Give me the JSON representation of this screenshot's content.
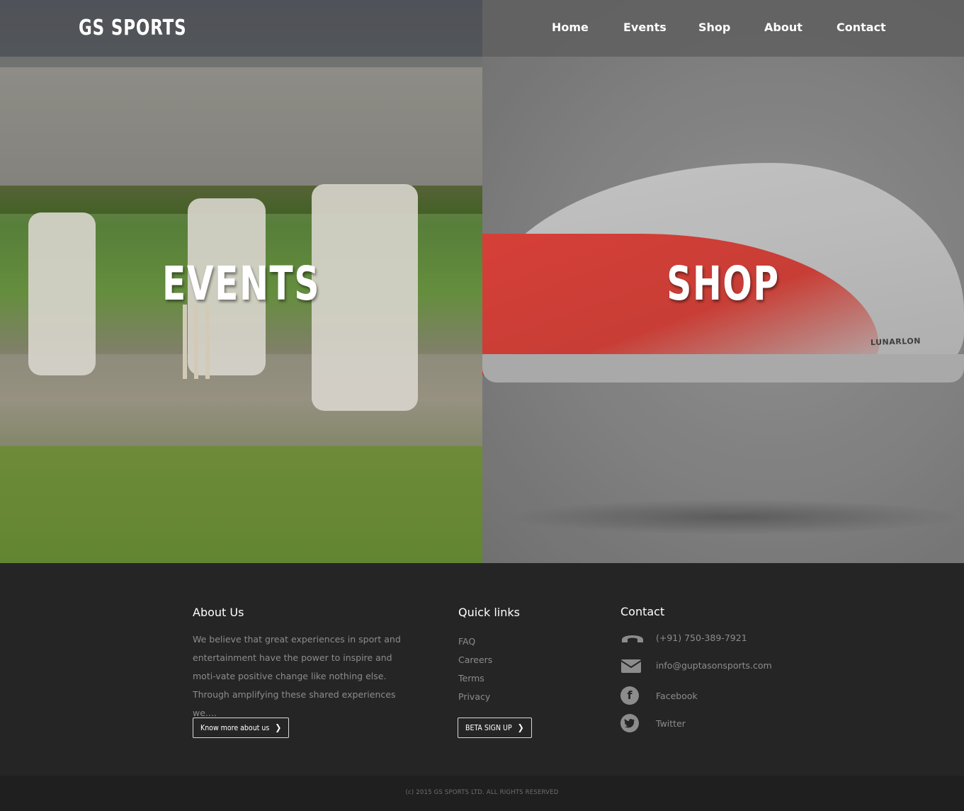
{
  "brand": {
    "logo_text": "GS SPORTS"
  },
  "nav": {
    "items": [
      {
        "label": "Home"
      },
      {
        "label": "Events"
      },
      {
        "label": "Shop"
      },
      {
        "label": "About"
      },
      {
        "label": "Contact"
      }
    ]
  },
  "hero": {
    "events_title": "EVENTS",
    "shop_title": "SHOP",
    "shoe_brand_text": "LUNARLON"
  },
  "footer": {
    "about": {
      "heading": "About Us",
      "text": "We believe  that  great experiences in sport and entertainment have the power to inspire and moti-vate positive change like nothing else. Through amplifying these  shared experiences we....",
      "button_label": "Know more about us"
    },
    "quick_links": {
      "heading": "Quick links",
      "items": [
        {
          "label": "FAQ"
        },
        {
          "label": "Careers"
        },
        {
          "label": "Terms"
        },
        {
          "label": "Privacy"
        }
      ],
      "button_label": "BETA SIGN UP"
    },
    "contact": {
      "heading": "Contact",
      "phone": "(+91) 750-389-7921",
      "email": "info@guptasonsports.com",
      "facebook": "Facebook",
      "twitter": "Twitter"
    },
    "copyright": "(c) 2015 GS SPORTS LTD. ALL RIGHTS RESERVED"
  },
  "colors": {
    "footer_bg": "#252525",
    "muted_text": "#8c8c8c",
    "accent_red": "#d9443b"
  },
  "icons": {
    "phone": "phone-icon",
    "email": "envelope-icon",
    "facebook": "facebook-icon",
    "twitter": "twitter-icon",
    "chevron": "chevron-right-icon"
  }
}
